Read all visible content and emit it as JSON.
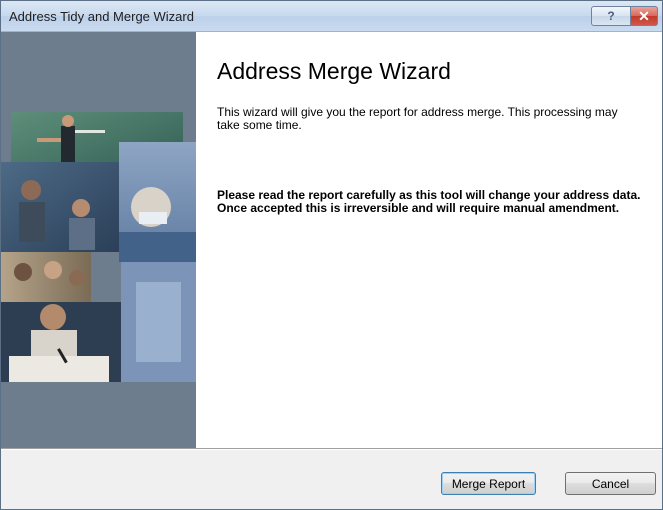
{
  "window": {
    "title": "Address Tidy and Merge Wizard",
    "help_label": "?",
    "close_label": "✕"
  },
  "sidebar": {
    "image": "students-collage-image"
  },
  "main": {
    "heading": "Address Merge Wizard",
    "intro": "This wizard will give you the report for address merge.  This processing may take some time.",
    "warning": "Please read the report carefully as this tool will change your address data. Once accepted this is irreversible and will require manual amendment."
  },
  "footer": {
    "merge_report_label": "Merge Report",
    "cancel_label": "Cancel"
  },
  "colors": {
    "sidebar_bg": "#6e7d8d",
    "content_bg": "#ffffff",
    "footer_bg": "#f0f0f0",
    "close_button": "#c0392b"
  }
}
